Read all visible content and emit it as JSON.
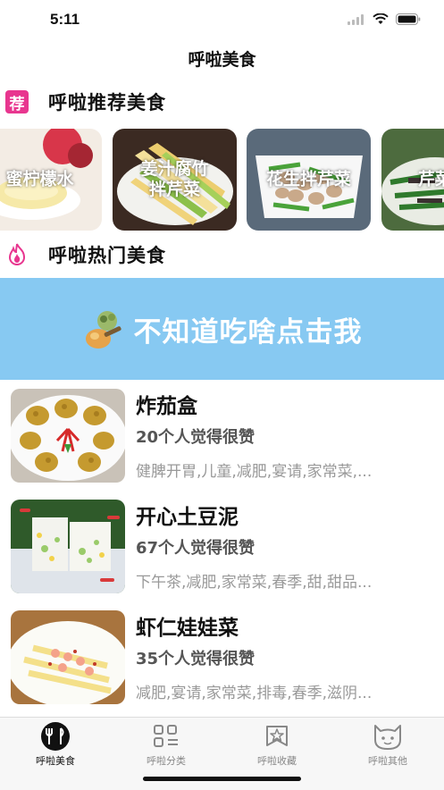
{
  "status": {
    "time": "5:11"
  },
  "nav": {
    "title": "呼啦美食"
  },
  "sections": {
    "recommend": {
      "title": "呼啦推荐美食",
      "badge": "荐"
    },
    "hot": {
      "title": "呼啦热门美食"
    }
  },
  "recommend_cards": [
    {
      "label": "蜜柠檬水"
    },
    {
      "label": "姜汁腐竹\n拌芹菜"
    },
    {
      "label": "花生拌芹菜"
    },
    {
      "label": "芹菜炒"
    }
  ],
  "banner": {
    "text": "不知道吃啥点击我"
  },
  "foods": [
    {
      "name": "炸茄盒",
      "likes": "20个人觉得很赞",
      "tags": "健脾开胃,儿童,减肥,宴请,家常菜,..."
    },
    {
      "name": "开心土豆泥",
      "likes": "67个人觉得很赞",
      "tags": "下午茶,减肥,家常菜,春季,甜,甜品..."
    },
    {
      "name": "虾仁娃娃菜",
      "likes": "35个人觉得很赞",
      "tags": "减肥,宴请,家常菜,排毒,春季,滋阴..."
    }
  ],
  "tabs": [
    {
      "label": "呼啦美食",
      "active": true
    },
    {
      "label": "呼啦分类"
    },
    {
      "label": "呼啦收藏"
    },
    {
      "label": "呼啦其他"
    }
  ],
  "colors": {
    "banner": "#87c9f2",
    "badge": "#e8368f",
    "fire": "#e8368f"
  }
}
